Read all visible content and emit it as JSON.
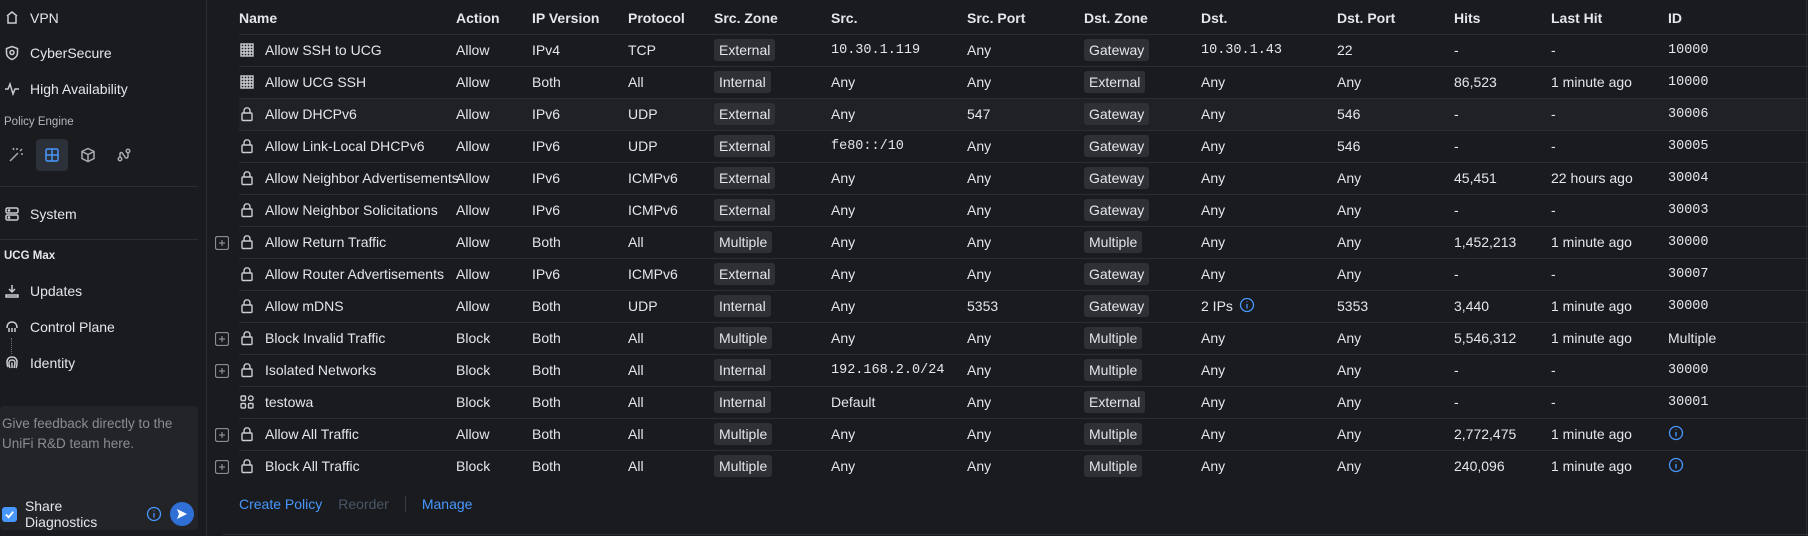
{
  "sidebar": {
    "vpn": "VPN",
    "cybersecure": "CyberSecure",
    "high_availability": "High Availability",
    "policy_engine": "Policy Engine",
    "system": "System",
    "device_section": "UCG Max",
    "updates": "Updates",
    "control_plane": "Control Plane",
    "identity": "Identity",
    "feedback_text": "Give feedback directly to the UniFi R&D team here.",
    "share_diagnostics": "Share Diagnostics"
  },
  "table": {
    "headers": [
      "Name",
      "Action",
      "IP Version",
      "Protocol",
      "Src. Zone",
      "Src.",
      "Src. Port",
      "Dst. Zone",
      "Dst.",
      "Dst. Port",
      "Hits",
      "Last Hit",
      "ID"
    ],
    "rows": [
      {
        "name": "Allow SSH to UCG",
        "icon": "grid-icon",
        "expand": false,
        "action": "Allow",
        "ipver": "IPv4",
        "protocol": "TCP",
        "src_zone": "External",
        "src": "10.30.1.119",
        "src_port": "Any",
        "dst_zone": "Gateway",
        "dst": "10.30.1.43",
        "dst_port": "22",
        "hits": "-",
        "last_hit": "-",
        "id": "10000"
      },
      {
        "name": "Allow UCG SSH",
        "icon": "grid-icon",
        "expand": false,
        "action": "Allow",
        "ipver": "Both",
        "protocol": "All",
        "src_zone": "Internal",
        "src": "Any",
        "src_port": "Any",
        "dst_zone": "External",
        "dst": "Any",
        "dst_port": "Any",
        "hits": "86,523",
        "last_hit": "1 minute ago",
        "id": "10000"
      },
      {
        "name": "Allow DHCPv6",
        "icon": "lock-icon",
        "expand": false,
        "action": "Allow",
        "ipver": "IPv6",
        "protocol": "UDP",
        "src_zone": "External",
        "src": "Any",
        "src_port": "547",
        "dst_zone": "Gateway",
        "dst": "Any",
        "dst_port": "546",
        "hits": "-",
        "last_hit": "-",
        "id": "30006"
      },
      {
        "name": "Allow Link-Local DHCPv6",
        "icon": "lock-icon",
        "expand": false,
        "action": "Allow",
        "ipver": "IPv6",
        "protocol": "UDP",
        "src_zone": "External",
        "src": "fe80::/10",
        "src_port": "Any",
        "dst_zone": "Gateway",
        "dst": "Any",
        "dst_port": "546",
        "hits": "-",
        "last_hit": "-",
        "id": "30005"
      },
      {
        "name": "Allow Neighbor Advertisements",
        "icon": "lock-icon",
        "expand": false,
        "action": "Allow",
        "ipver": "IPv6",
        "protocol": "ICMPv6",
        "src_zone": "External",
        "src": "Any",
        "src_port": "Any",
        "dst_zone": "Gateway",
        "dst": "Any",
        "dst_port": "Any",
        "hits": "45,451",
        "last_hit": "22 hours ago",
        "id": "30004"
      },
      {
        "name": "Allow Neighbor Solicitations",
        "icon": "lock-icon",
        "expand": false,
        "action": "Allow",
        "ipver": "IPv6",
        "protocol": "ICMPv6",
        "src_zone": "External",
        "src": "Any",
        "src_port": "Any",
        "dst_zone": "Gateway",
        "dst": "Any",
        "dst_port": "Any",
        "hits": "-",
        "last_hit": "-",
        "id": "30003"
      },
      {
        "name": "Allow Return Traffic",
        "icon": "lock-icon",
        "expand": true,
        "action": "Allow",
        "ipver": "Both",
        "protocol": "All",
        "src_zone": "Multiple",
        "src": "Any",
        "src_port": "Any",
        "dst_zone": "Multiple",
        "dst": "Any",
        "dst_port": "Any",
        "hits": "1,452,213",
        "last_hit": "1 minute ago",
        "id": "30000"
      },
      {
        "name": "Allow Router Advertisements",
        "icon": "lock-icon",
        "expand": false,
        "action": "Allow",
        "ipver": "IPv6",
        "protocol": "ICMPv6",
        "src_zone": "External",
        "src": "Any",
        "src_port": "Any",
        "dst_zone": "Gateway",
        "dst": "Any",
        "dst_port": "Any",
        "hits": "-",
        "last_hit": "-",
        "id": "30007"
      },
      {
        "name": "Allow mDNS",
        "icon": "lock-icon",
        "expand": false,
        "action": "Allow",
        "ipver": "Both",
        "protocol": "UDP",
        "src_zone": "Internal",
        "src": "Any",
        "src_port": "5353",
        "dst_zone": "Gateway",
        "dst": "2 IPs",
        "dst_info": true,
        "dst_port": "5353",
        "hits": "3,440",
        "last_hit": "1 minute ago",
        "id": "30000"
      },
      {
        "name": "Block Invalid Traffic",
        "icon": "lock-icon",
        "expand": true,
        "action": "Block",
        "ipver": "Both",
        "protocol": "All",
        "src_zone": "Multiple",
        "src": "Any",
        "src_port": "Any",
        "dst_zone": "Multiple",
        "dst": "Any",
        "dst_port": "Any",
        "hits": "5,546,312",
        "last_hit": "1 minute ago",
        "id": "Multiple"
      },
      {
        "name": "Isolated Networks",
        "icon": "lock-icon",
        "expand": true,
        "action": "Block",
        "ipver": "Both",
        "protocol": "All",
        "src_zone": "Internal",
        "src": "192.168.2.0/24",
        "src_port": "Any",
        "dst_zone": "Multiple",
        "dst": "Any",
        "dst_port": "Any",
        "hits": "-",
        "last_hit": "-",
        "id": "30000"
      },
      {
        "name": "testowa",
        "icon": "apps-icon",
        "expand": false,
        "action": "Block",
        "ipver": "Both",
        "protocol": "All",
        "src_zone": "Internal",
        "src": "Default",
        "src_port": "Any",
        "dst_zone": "External",
        "dst": "Any",
        "dst_port": "Any",
        "hits": "-",
        "last_hit": "-",
        "id": "30001"
      },
      {
        "name": "Allow All Traffic",
        "icon": "lock-icon",
        "expand": true,
        "action": "Allow",
        "ipver": "Both",
        "protocol": "All",
        "src_zone": "Multiple",
        "src": "Any",
        "src_port": "Any",
        "dst_zone": "Multiple",
        "dst": "Any",
        "dst_port": "Any",
        "hits": "2,772,475",
        "last_hit": "1 minute ago",
        "id": "",
        "id_info": true
      },
      {
        "name": "Block All Traffic",
        "icon": "lock-icon",
        "expand": true,
        "action": "Block",
        "ipver": "Both",
        "protocol": "All",
        "src_zone": "Multiple",
        "src": "Any",
        "src_port": "Any",
        "dst_zone": "Multiple",
        "dst": "Any",
        "dst_port": "Any",
        "hits": "240,096",
        "last_hit": "1 minute ago",
        "id": "",
        "id_info": true
      }
    ]
  },
  "footer": {
    "create_policy": "Create Policy",
    "reorder": "Reorder",
    "manage": "Manage"
  },
  "colors": {
    "accent": "#4797ff",
    "background": "#1a1b1e",
    "zone_chip": "#2e3034"
  }
}
